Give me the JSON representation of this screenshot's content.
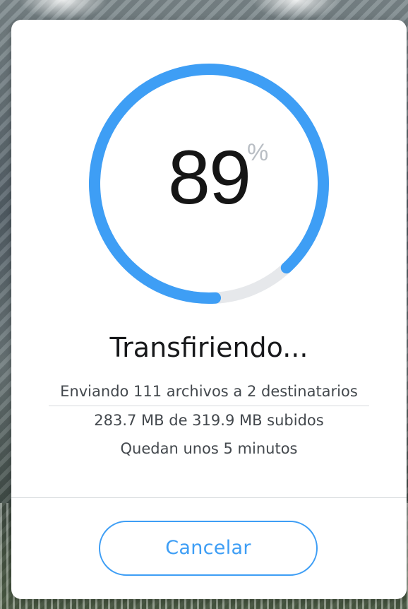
{
  "progress": {
    "value": "89",
    "fraction": 0.89,
    "unit": "%",
    "colors": {
      "fill": "#3e9ef5",
      "track": "#e6e8eb"
    }
  },
  "status": {
    "title": "Transfiriendo..."
  },
  "details": {
    "files_line": "Enviando 111 archivos a 2 destinatarios",
    "size_line": "283.7 MB de 319.9 MB subidos",
    "time_line": "Quedan unos 5 minutos"
  },
  "actions": {
    "cancel_label": "Cancelar"
  }
}
